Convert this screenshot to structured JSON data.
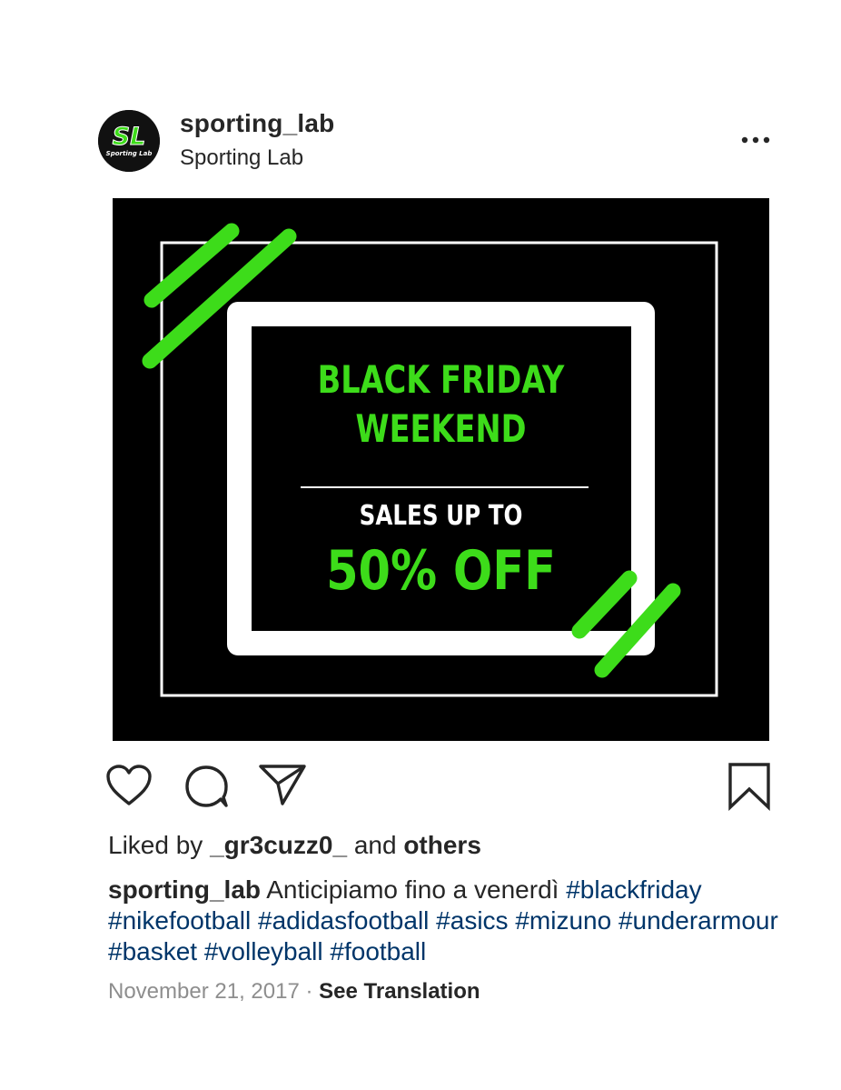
{
  "header": {
    "username": "sporting_lab",
    "display_name": "Sporting Lab",
    "avatar_text": "SL",
    "avatar_subtext": "Sporting Lab",
    "more_icon": "more-horizontal-icon"
  },
  "post_image": {
    "title_line_1": "BLACK FRIDAY",
    "title_line_2": "WEEKEND",
    "subtitle": "SALES UP TO",
    "discount": "50% OFF"
  },
  "actions": {
    "like_icon": "heart-icon",
    "comment_icon": "comment-icon",
    "share_icon": "send-icon",
    "save_icon": "bookmark-icon"
  },
  "likes": {
    "prefix": "Liked by",
    "user": "_gr3cuzz0_",
    "middle": "and",
    "others": "others"
  },
  "caption": {
    "username": "sporting_lab",
    "text": "Anticipiamo fino a venerdì",
    "hashtags": [
      "#blackfriday",
      "#nikefootball",
      "#adidasfootball",
      "#asics",
      "#mizuno",
      "#underarmour",
      "#basket",
      "#volleyball",
      "#football"
    ]
  },
  "meta": {
    "date": "November 21, 2017",
    "separator": "·",
    "see_translation": "See Translation"
  },
  "colors": {
    "accent_green": "#3ddc1a",
    "hashtag_blue": "#003569",
    "text": "#262626",
    "muted": "#8e8e8e"
  }
}
